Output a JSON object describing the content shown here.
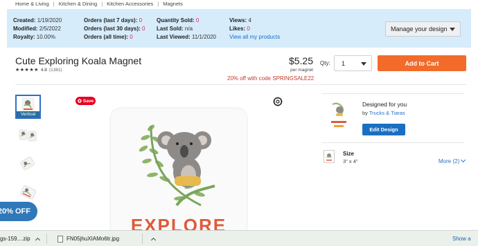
{
  "breadcrumb": [
    "Home & Living",
    "Kitchen & Dining",
    "Kitchen Accessories",
    "Magnets"
  ],
  "stats": {
    "col1": [
      {
        "label": "Created:",
        "value": "1/19/2020"
      },
      {
        "label": "Modified:",
        "value": "2/5/2022"
      },
      {
        "label": "Royalty:",
        "value": "10.00%"
      }
    ],
    "col2": [
      {
        "label": "Orders  (last 7 days):",
        "value": "0"
      },
      {
        "label": "Orders  (last 30 days):",
        "value": "0"
      },
      {
        "label": "Orders  (all time):",
        "value": "0"
      }
    ],
    "col3": [
      {
        "label": "Quantity Sold:",
        "value": "0"
      },
      {
        "label": "Last Sold:",
        "value": "n/a"
      },
      {
        "label": "Last Viewed:",
        "value": "11/1/2020"
      }
    ],
    "col4": [
      {
        "label": "Views:",
        "value": "4"
      },
      {
        "label": "Likes:",
        "value": "0"
      }
    ],
    "view_all_link": "View all my products",
    "manage_button": "Manage your design"
  },
  "product": {
    "title": "Cute Exploring Koala Magnet",
    "stars": "★★★★★",
    "rating": "4.8",
    "review_count": "(1381)",
    "price": "$5.25",
    "per_unit": "per magnet",
    "promo": "20% off with code SPRINGSALE22",
    "qty_label": "Qty:",
    "qty_value": "1",
    "add_to_cart": "Add to Cart"
  },
  "gallery": {
    "selected_label": "Vertical",
    "save_label": "Save",
    "magnet_text": "EXPLORE"
  },
  "badge": {
    "off_text": "20% OFF"
  },
  "design": {
    "title": "Designed for you",
    "by_prefix": "by",
    "by_link": "Trucks & Tiaras",
    "edit_button": "Edit Design"
  },
  "size": {
    "title": "Size",
    "value": "3\" x 4\"",
    "more_link": "More (2)"
  },
  "downloads": {
    "item1": "gs-159....zip",
    "item2": "FN05jhuXIAMo6tr.jpg",
    "show_all": "Show a"
  },
  "colors": {
    "stats_bg": "#d6ecfb",
    "cart_orange": "#f26b2a",
    "link_blue": "#1a6fc9",
    "promo_red": "#c0392b",
    "badge_blue": "#2f78b9",
    "save_red": "#e60023"
  }
}
